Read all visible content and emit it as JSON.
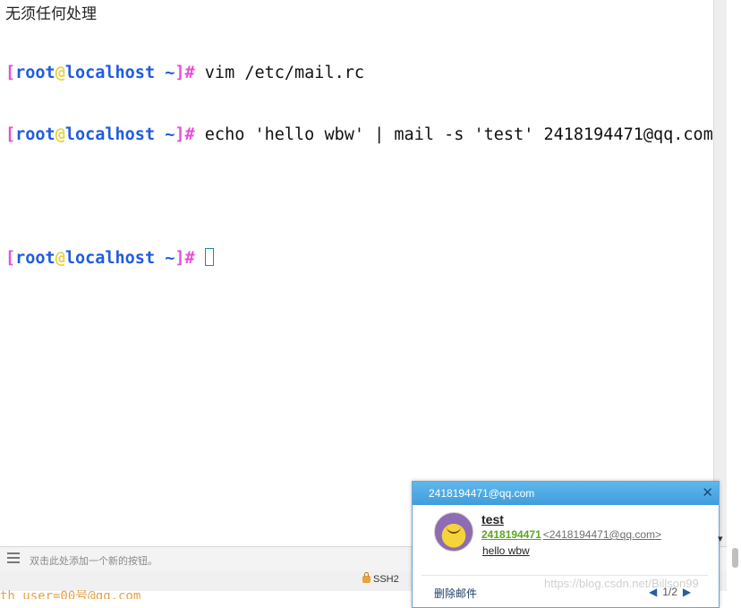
{
  "caption": "无须任何处理",
  "terminal": {
    "prompt": {
      "open": "[",
      "user": "root",
      "at": "@",
      "host": "localhost",
      "path": " ~",
      "close": "]",
      "hash": "#"
    },
    "lines": [
      {
        "command": " vim /etc/mail.rc"
      },
      {
        "command": " echo 'hello wbw' | mail -s 'test' 2418194471@qq.com"
      },
      {
        "command": " "
      }
    ]
  },
  "button_bar": {
    "hint": "双击此处添加一个新的按钮。"
  },
  "status_bar": {
    "protocol": "SSH2"
  },
  "bottom_partial_text": "th_user=00号@qq.com",
  "notification": {
    "account": "2418194471@qq.com",
    "subject": "test",
    "sender_name": "2418194471",
    "sender_address": "<2418194471@qq.com>",
    "preview": "hello wbw",
    "delete_label": "删除邮件",
    "page": "1/2",
    "close_glyph": "✕",
    "prev_glyph": "◀",
    "next_glyph": "▶"
  },
  "watermark": "https://blog.csdn.net/Billson99"
}
